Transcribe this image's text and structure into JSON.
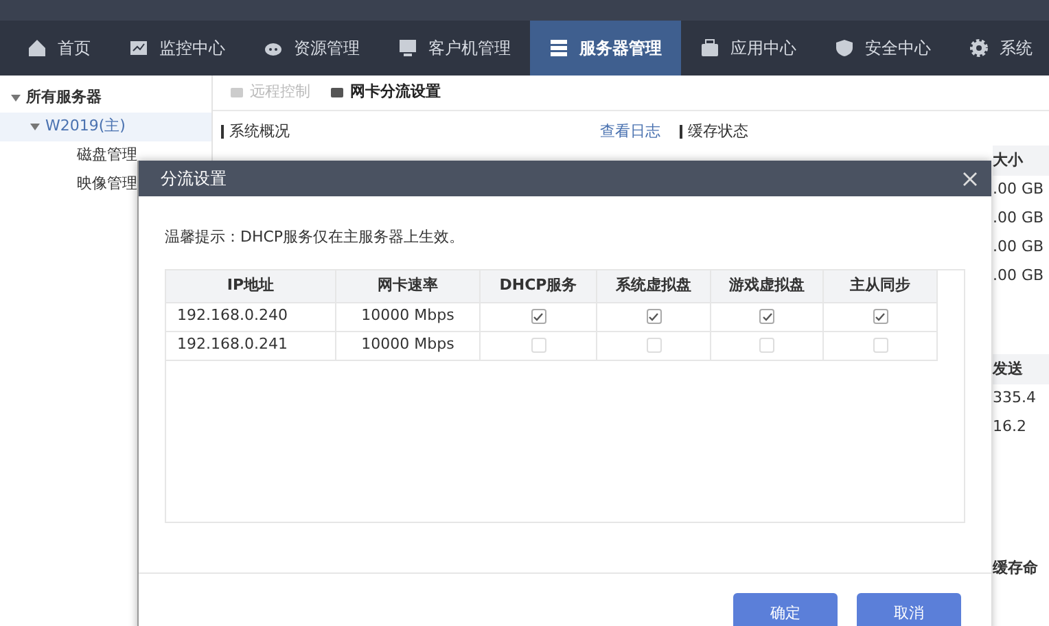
{
  "nav": [
    {
      "label": "首页",
      "selected": false
    },
    {
      "label": "监控中心",
      "selected": false
    },
    {
      "label": "资源管理",
      "selected": false
    },
    {
      "label": "客户机管理",
      "selected": false
    },
    {
      "label": "服务器管理",
      "selected": true
    },
    {
      "label": "应用中心",
      "selected": false
    },
    {
      "label": "安全中心",
      "selected": false
    },
    {
      "label": "系统",
      "selected": false
    }
  ],
  "sidebar": {
    "items": [
      {
        "label": "所有服务器",
        "expanded": true,
        "children": [
          {
            "label": "W2019(主)",
            "expanded": true,
            "children": [
              {
                "label": "磁盘管理"
              },
              {
                "label": "映像管理"
              }
            ]
          }
        ]
      }
    ]
  },
  "toolbar": [
    {
      "label": "远程控制",
      "disabled": true
    },
    {
      "label": "网卡分流设置",
      "disabled": false
    }
  ],
  "sections": {
    "overview": "系统概况",
    "log_link": "查看日志",
    "cache": "缓存状态"
  },
  "cache_table": {
    "column_header": "大小",
    "cells": [
      ".00 GB",
      ".00 GB",
      ".00 GB",
      ".00 GB"
    ]
  },
  "traffic_table": {
    "column_header": "发送",
    "cells": [
      "335.4",
      "16.2"
    ]
  },
  "hit_label": "缓存命",
  "dialog": {
    "title": "分流设置",
    "hint": "温馨提示：DHCP服务仅在主服务器上生效。",
    "columns": [
      "IP地址",
      "网卡速率",
      "DHCP服务",
      "系统虚拟盘",
      "游戏虚拟盘",
      "主从同步"
    ],
    "rows": [
      {
        "ip": "192.168.0.240",
        "speed": "10000 Mbps",
        "checks": [
          true,
          true,
          true,
          true
        ]
      },
      {
        "ip": "192.168.0.241",
        "speed": "10000 Mbps",
        "checks": [
          false,
          false,
          false,
          false
        ]
      }
    ],
    "buttons": [
      "确定",
      "取消"
    ]
  }
}
